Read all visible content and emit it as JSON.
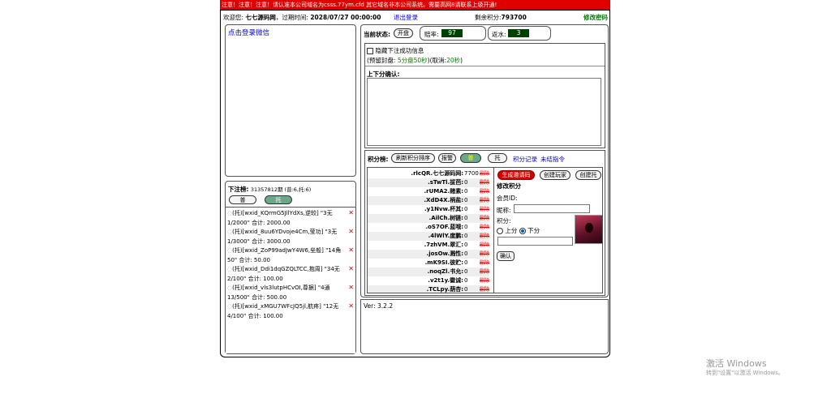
{
  "notice": "注意！注意！注意！请认准本公司域名为csss.77ym.cfd 其它域名非本公司系统。需要高网8请联系上级开通!",
  "topbar": {
    "welcome_label": "欢迎您:",
    "user": "七七源码网",
    "expire_label": "，过期时间:",
    "expire_time": "2028/07/27 00:00:00",
    "logout": "退出登录",
    "points_label": "剩余积分:",
    "points_value": "793700",
    "change_password": "修改密码"
  },
  "wechat_login": "点击登录微信",
  "bets": {
    "header": "下注榜:",
    "summary": "31357812期 (普:6,托:6)",
    "btn_normal": "普",
    "btn_tuo": "托",
    "items": [
      {
        "line1": "(托)[wxid_KQrmG5JllYdXs,逆较] \"3无",
        "line2": "1/2000\" 合计: 2000.00"
      },
      {
        "line1": "(托)[wxid_8uu6YDvoje4Cm,莹功] \"3无",
        "line2": "1/3000\" 合计: 3000.00"
      },
      {
        "line1": "(托)[wxid_ZoP99adJwY4W6,垒般] \"14角",
        "line2": "50\" 合计: 50.00"
      },
      {
        "line1": "(托)[wxid_Ddi1dqGZQLTCC,抱周] \"34无",
        "line2": "2/100\" 合计: 100.00"
      },
      {
        "line1": "(托)[wxid_vls3lutpHCvOI,尊据] \"4通",
        "line2": "13/500\" 合计: 500.00"
      },
      {
        "line1": "(托)[wxid_xMGU7WFcJQ5jl,航疼] \"12无",
        "line2": "4/100\" 合计: 100.00"
      }
    ]
  },
  "status": {
    "label": "当前状态:",
    "state_button": "开盘",
    "odds_label": "赔率:",
    "odds_value": "97",
    "rebate_label": "返水:",
    "rebate_value": "3"
  },
  "options": {
    "hide_success": "隐藏下注成功信息",
    "seal_info_prefix": "(预留封盘:",
    "seal_info_value": "5分盘50秒",
    "seal_info_mid": ")(取消:",
    "cancel_value": "20秒",
    "seal_info_suffix": ")"
  },
  "confirm_label": "上下分确认:",
  "points_bar": {
    "label": "积分榜:",
    "refresh": "刷新积分排序",
    "report": "报警",
    "normal": "普",
    "tuo": "托",
    "history": "积分记录",
    "unsettled": "未结指令"
  },
  "players": [
    {
      "name": ".rlcQR.七七源码网:",
      "value": "7700"
    },
    {
      "name": ".sTwTl.拔芭:",
      "value": "0"
    },
    {
      "name": ".rUMA2.赌素:",
      "value": "0"
    },
    {
      "name": ".XdD4X.柄盐:",
      "value": "0"
    },
    {
      "name": ".y1Nvw.杯其:",
      "value": "0"
    },
    {
      "name": ".AilCh.树链:",
      "value": "0"
    },
    {
      "name": ".oS7OF.蓝哦:",
      "value": "0"
    },
    {
      "name": ".4lWlY.度鹏:",
      "value": "0"
    },
    {
      "name": ".7zhVM.翠汇:",
      "value": "0"
    },
    {
      "name": ".josOw.溅性:",
      "value": "0"
    },
    {
      "name": ".mK9SI.彼贮:",
      "value": "0"
    },
    {
      "name": ".noqZl.书允:",
      "value": "0"
    },
    {
      "name": ".v2t1y.徽诚:",
      "value": "0"
    },
    {
      "name": ".TCLpy.荫杏:",
      "value": "0"
    }
  ],
  "player_delete": "删除",
  "manage": {
    "gen_invite": "生成邀请码",
    "create_player": "创建玩家",
    "create_tuo": "创建托",
    "edit_points": "修改积分",
    "member_id_label": "会员ID:",
    "nickname_label": "昵称:",
    "points_label": "积分:",
    "up": "上分",
    "down": "下分",
    "confirm": "确认"
  },
  "version": "Ver: 3.2.2",
  "watermark": {
    "line1": "激活 Windows",
    "line2": "转到\"设置\"以激活 Windows。"
  },
  "colors": {
    "notice_bg": "#e00000",
    "link": "#0000cc",
    "accent_green": "#008000",
    "value_box": "#004000"
  }
}
